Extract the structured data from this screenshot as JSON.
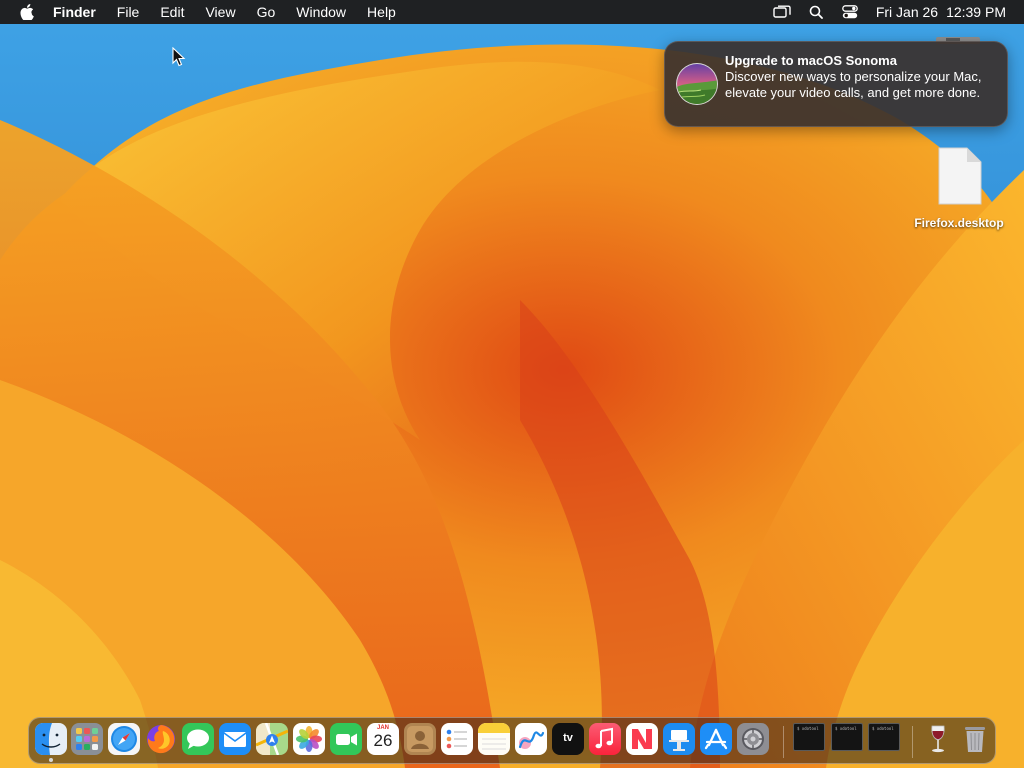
{
  "menubar": {
    "apple_icon": "apple-logo-icon",
    "app_name": "Finder",
    "menus": [
      "File",
      "Edit",
      "View",
      "Go",
      "Window",
      "Help"
    ],
    "status_icons": [
      "screen-mirroring-icon",
      "spotlight-search-icon",
      "control-center-icon"
    ],
    "date": "Fri Jan 26",
    "time": "12:39 PM"
  },
  "notification": {
    "icon": "macos-sonoma-icon",
    "title": "Upgrade to macOS Sonoma",
    "body": "Discover new ways to personalize your Mac, elevate your video calls, and get more done."
  },
  "desktop": {
    "files": [
      {
        "name": "Firefox.desktop",
        "icon": "document-icon"
      }
    ]
  },
  "dock": {
    "apps": [
      {
        "name": "Finder",
        "icon": "finder-icon",
        "running": true
      },
      {
        "name": "Launchpad",
        "icon": "launchpad-icon",
        "running": false
      },
      {
        "name": "Safari",
        "icon": "safari-icon",
        "running": false
      },
      {
        "name": "Firefox",
        "icon": "firefox-icon",
        "running": false
      },
      {
        "name": "Messages",
        "icon": "messages-icon",
        "running": false
      },
      {
        "name": "Mail",
        "icon": "mail-icon",
        "running": false
      },
      {
        "name": "Maps",
        "icon": "maps-icon",
        "running": false
      },
      {
        "name": "Photos",
        "icon": "photos-icon",
        "running": false
      },
      {
        "name": "FaceTime",
        "icon": "facetime-icon",
        "running": false
      },
      {
        "name": "Calendar",
        "icon": "calendar-icon",
        "running": false,
        "month": "JAN",
        "day": "26"
      },
      {
        "name": "Contacts",
        "icon": "contacts-icon",
        "running": false
      },
      {
        "name": "Reminders",
        "icon": "reminders-icon",
        "running": false
      },
      {
        "name": "Notes",
        "icon": "notes-icon",
        "running": false
      },
      {
        "name": "Freeform",
        "icon": "freeform-icon",
        "running": false
      },
      {
        "name": "TV",
        "icon": "apple-tv-icon",
        "running": false,
        "label": "tv"
      },
      {
        "name": "Music",
        "icon": "music-icon",
        "running": false
      },
      {
        "name": "News",
        "icon": "news-icon",
        "running": false
      },
      {
        "name": "Keynote",
        "icon": "keynote-icon",
        "running": false
      },
      {
        "name": "App Store",
        "icon": "app-store-icon",
        "running": false
      },
      {
        "name": "System Settings",
        "icon": "system-settings-icon",
        "running": false
      }
    ],
    "minimized_windows": [
      {
        "icon": "terminal-window-thumbnail",
        "text": "$ xdotool"
      },
      {
        "icon": "terminal-window-thumbnail",
        "text": "$ xdotool"
      },
      {
        "icon": "terminal-window-thumbnail",
        "text": "$ xdotool"
      }
    ],
    "trailing": [
      {
        "name": "Wine",
        "icon": "wine-glass-icon"
      },
      {
        "name": "Trash",
        "icon": "trash-icon"
      }
    ]
  },
  "colors": {
    "wallpaper_orange": "#f5a21c",
    "wallpaper_red": "#d9421a",
    "wallpaper_blue": "#2e86d4",
    "menubar_bg": "#1c1612",
    "notification_bg": "#3a322e"
  }
}
